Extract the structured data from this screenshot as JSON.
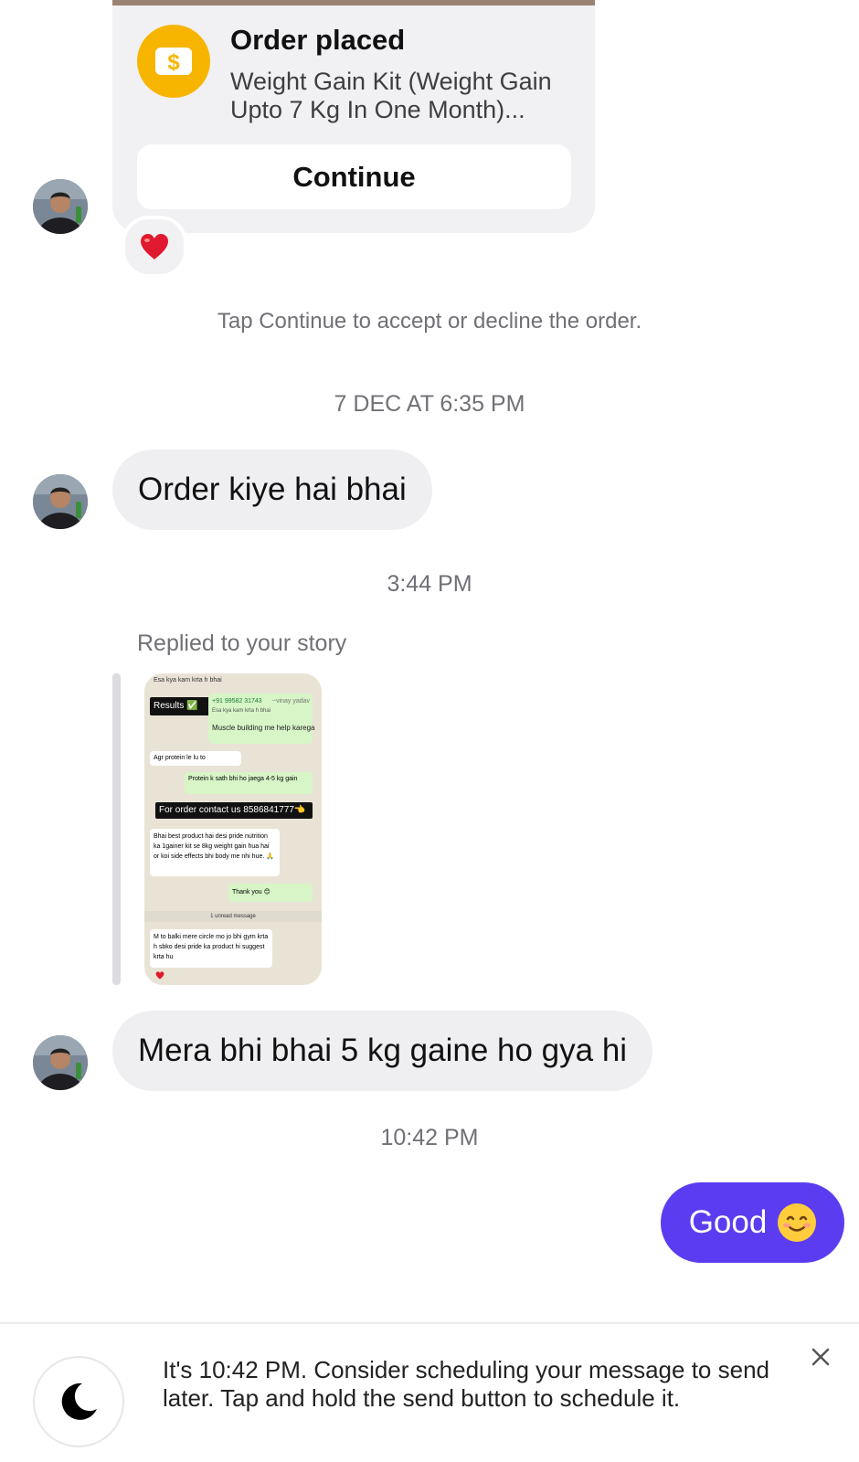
{
  "order_card": {
    "title": "Order placed",
    "description": "Weight Gain Kit (Weight Gain Upto 7 Kg In One Month)...",
    "continue_label": "Continue",
    "icon": "dollar-icon",
    "reaction": "❤️"
  },
  "hint": "Tap Continue to accept or decline the order.",
  "timestamps": [
    "7 DEC AT 6:35 PM",
    "3:44 PM",
    "10:42 PM"
  ],
  "messages": {
    "received_1": "Order kiye hai bhai",
    "replied_label": "Replied to your story",
    "received_2": "Mera bhi bhai 5 kg gaine ho gya hi",
    "sent_1": "Good"
  },
  "story_preview": {
    "lines": [
      "Esa kya kam krta h bhai",
      "Results ✅",
      "+91 99582 31743",
      "~vinay yadav",
      "Esa kya kam krta h bhai",
      "Muscle building me help karega",
      "Agr protein le lu to",
      "Protein k sath bhi ho jaega 4-5 kg gain",
      "For order contact us 8586841777👈",
      "Bhai best product hai desi pride nutrition ka 1gainer kit se 8kg weight gain hua hai or koi side effects bhi body me nhi hue. 🙏",
      "Thank you 😊",
      "1 unread message",
      "M to balki mere circle mo jo bhi gym krta h sbko desi pride ka product hi suggest krta hu"
    ]
  },
  "banner": {
    "text": "It's 10:42 PM. Consider scheduling your message to send later. Tap and hold the send button to schedule it.",
    "icon": "moon-icon",
    "close_icon": "close-icon"
  },
  "colors": {
    "accent": "#5b3cf0",
    "received_bubble": "#efeff1",
    "order_icon": "#f7b500"
  }
}
